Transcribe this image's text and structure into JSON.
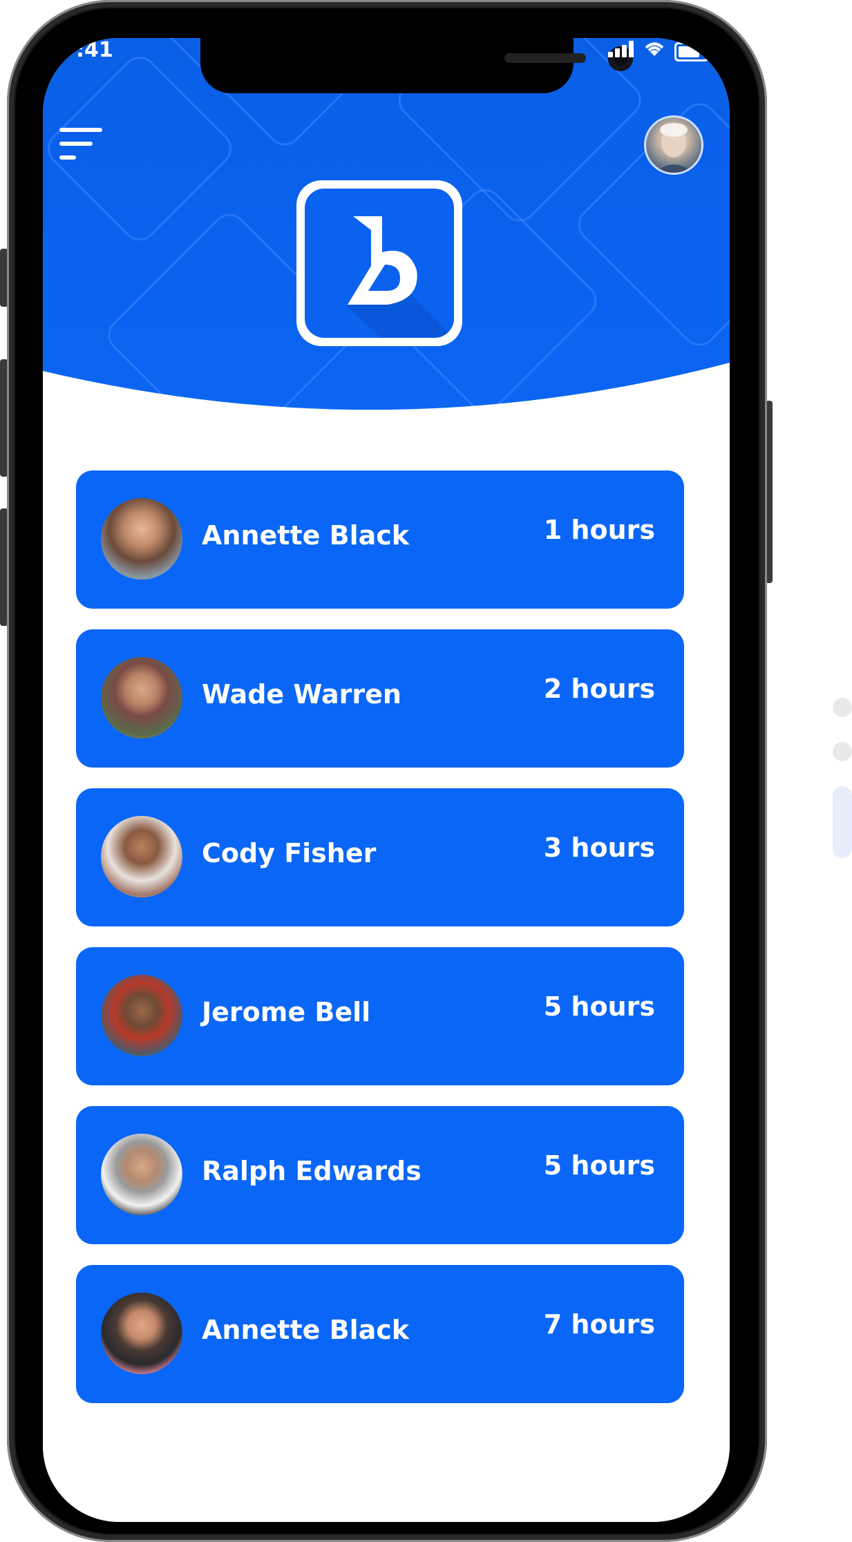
{
  "status_bar": {
    "time": ":41"
  },
  "header": {
    "menu_icon": "hamburger-menu-icon",
    "profile_icon": "user-avatar",
    "logo_letter": "B",
    "brand_color": "#0a62ef"
  },
  "list": {
    "items": [
      {
        "name": "Annette Black",
        "duration": "1 hours",
        "avatar_color": "#6b4a3a"
      },
      {
        "name": "Wade Warren",
        "duration": "2 hours",
        "avatar_color": "#5a6a4a"
      },
      {
        "name": "Cody Fisher",
        "duration": "3 hours",
        "avatar_color": "#a2786a"
      },
      {
        "name": "Jerome Bell",
        "duration": "5 hours",
        "avatar_color": "#4a5a6a"
      },
      {
        "name": "Ralph Edwards",
        "duration": "5 hours",
        "avatar_color": "#3a3a3a"
      },
      {
        "name": "Annette Black",
        "duration": "7 hours",
        "avatar_color": "#e98aa0"
      }
    ]
  },
  "colors": {
    "card": "#0a66f6",
    "header": "#0a62ef",
    "text_on_primary": "#ffffff"
  }
}
